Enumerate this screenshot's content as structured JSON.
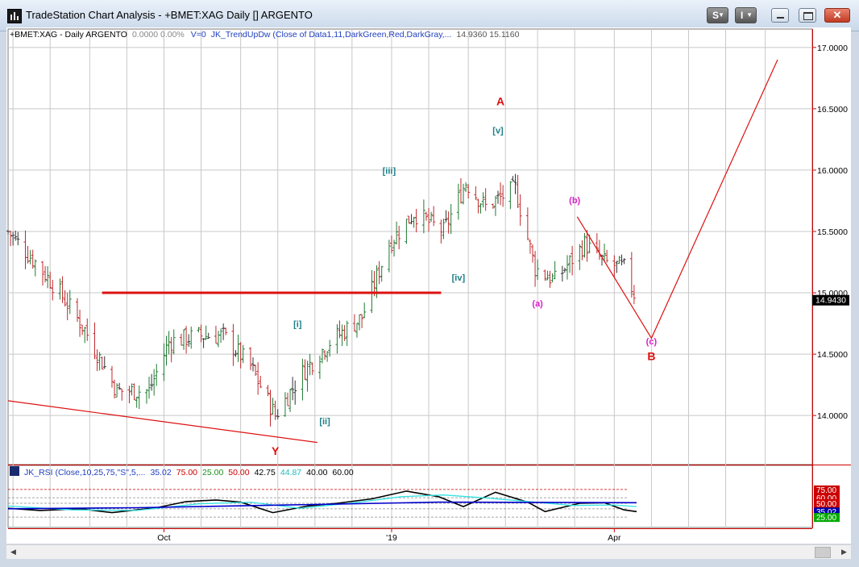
{
  "window": {
    "title": "TradeStation Chart Analysis - +BMET:XAG Daily [] ARGENTO",
    "btn_s": "S",
    "btn_i": "I",
    "btn_close_glyph": "✕",
    "icons": {
      "app": "chart-app-icon",
      "minimize": "minimize-icon",
      "maximize": "maximize-icon",
      "close": "close-icon"
    }
  },
  "price_header": {
    "symbol_text": "+BMET:XAG - Daily  ARGENTO",
    "stats_text": "0.0000   0.00%",
    "volume_text": "V=0",
    "indicator_text": "JK_TrendUpDw (Close of Data1,11,DarkGreen,Red,DarkGray,...",
    "values_text": "14.9360   15.1160"
  },
  "rsi_header": {
    "name_text": "JK_RSI (Close,10,25,75,\"S\",5,...",
    "v1": "35.02",
    "v2": "75.00",
    "v3": "25.00",
    "v4": "50.00",
    "v5": "42.75",
    "v6": "44.87",
    "v7": "40.00",
    "v8": "60.00"
  },
  "chart_data": [
    {
      "type": "bar",
      "subtype": "ohlc",
      "x_axis": {
        "labels": [
          "Oct",
          "'19",
          "Apr"
        ],
        "range": [
          "2018-07-30",
          "2019-06-20"
        ],
        "label_dates": [
          "2018-10-01",
          "2019-01-01",
          "2019-04-01"
        ]
      },
      "y_axis": {
        "ylim": [
          13.6,
          17.15
        ],
        "ticks": [
          "14.0000",
          "14.5000",
          "15.0000",
          "15.5000",
          "16.0000",
          "16.5000",
          "17.0000"
        ],
        "tick_values": [
          14.0,
          14.5,
          15.0,
          15.5,
          16.0,
          16.5,
          17.0
        ]
      },
      "last_price": 14.943,
      "last_price_text": "14.9430",
      "grid": true,
      "colors": {
        "up": "#1e7b32",
        "down": "#c0282d",
        "neutral": "#333333",
        "annotation_red": "#dd1111",
        "annotation_teal": "#1a7f86",
        "annotation_magenta": "#d81fc8"
      },
      "series": [
        {
          "name": "+BMET:XAG",
          "approx_closes": [
            [
              "2018-07-30",
              15.5
            ],
            [
              "2018-08-10",
              15.25
            ],
            [
              "2018-08-20",
              15.0
            ],
            [
              "2018-08-30",
              14.7
            ],
            [
              "2018-09-12",
              14.2
            ],
            [
              "2018-09-25",
              14.2
            ],
            [
              "2018-10-03",
              14.6
            ],
            [
              "2018-10-15",
              14.65
            ],
            [
              "2018-10-25",
              14.65
            ],
            [
              "2018-11-05",
              14.4
            ],
            [
              "2018-11-15",
              14.0
            ],
            [
              "2018-11-26",
              14.35
            ],
            [
              "2018-12-07",
              14.6
            ],
            [
              "2018-12-20",
              14.8
            ],
            [
              "2018-12-31",
              15.4
            ],
            [
              "2019-01-10",
              15.65
            ],
            [
              "2019-01-22",
              15.5
            ],
            [
              "2019-01-31",
              15.9
            ],
            [
              "2019-02-08",
              15.7
            ],
            [
              "2019-02-20",
              15.85
            ],
            [
              "2019-02-28",
              15.2
            ],
            [
              "2019-03-08",
              15.1
            ],
            [
              "2019-03-20",
              15.4
            ],
            [
              "2019-03-28",
              15.25
            ],
            [
              "2019-04-05",
              15.2
            ],
            [
              "2019-04-10",
              14.94
            ]
          ]
        }
      ],
      "lines": [
        {
          "name": "support",
          "color": "#dd1111",
          "points": [
            [
              "2018-07-30",
              14.12
            ],
            [
              "2018-12-02",
              13.78
            ]
          ]
        },
        {
          "name": "resistance",
          "color": "#dd1111",
          "points": [
            [
              "2018-09-06",
              15.0
            ],
            [
              "2019-01-21",
              15.0
            ]
          ]
        },
        {
          "name": "projection",
          "color": "#dd1111",
          "points": [
            [
              "2019-03-17",
              15.62
            ],
            [
              "2019-04-16",
              14.63
            ],
            [
              "2019-06-06",
              16.9
            ]
          ]
        }
      ],
      "annotations": [
        {
          "text": "A",
          "x": "2019-02-14",
          "y": 16.53,
          "color": "red"
        },
        {
          "text": "Y",
          "x": "2018-11-15",
          "y": 13.68,
          "color": "red"
        },
        {
          "text": "B",
          "x": "2019-04-16",
          "y": 14.45,
          "color": "red"
        },
        {
          "text": "[v]",
          "x": "2019-02-13",
          "y": 16.3,
          "color": "teal"
        },
        {
          "text": "[iii]",
          "x": "2018-12-31",
          "y": 15.97,
          "color": "teal"
        },
        {
          "text": "[iv]",
          "x": "2019-01-28",
          "y": 15.1,
          "color": "teal"
        },
        {
          "text": "[i]",
          "x": "2018-11-24",
          "y": 14.72,
          "color": "teal"
        },
        {
          "text": "[ii]",
          "x": "2018-12-05",
          "y": 13.93,
          "color": "teal"
        },
        {
          "text": "(b)",
          "x": "2019-03-16",
          "y": 15.73,
          "color": "magenta"
        },
        {
          "text": "(a)",
          "x": "2019-03-01",
          "y": 14.89,
          "color": "magenta"
        },
        {
          "text": "(c)",
          "x": "2019-04-16",
          "y": 14.58,
          "color": "magenta"
        }
      ]
    },
    {
      "type": "line",
      "name": "JK_RSI",
      "y_axis": {
        "ylim": [
          12,
          88
        ],
        "tick_values": [
          75,
          60,
          50,
          35.02,
          25
        ]
      },
      "axis_labels": [
        "75.00",
        "60.00",
        "50.00",
        "35.02",
        "25.00"
      ],
      "axis_label_colors": [
        "#cc0000",
        "#cc0000",
        "#cc0000",
        "#0000aa",
        "#00aa00"
      ],
      "levels": [
        75,
        60,
        50,
        40,
        25
      ],
      "series": [
        {
          "name": "RSI",
          "color": "#000000",
          "points": [
            [
              "2018-07-30",
              41
            ],
            [
              "2018-08-12",
              37
            ],
            [
              "2018-08-28",
              40
            ],
            [
              "2018-09-10",
              33
            ],
            [
              "2018-09-28",
              42
            ],
            [
              "2018-10-10",
              53
            ],
            [
              "2018-10-22",
              56
            ],
            [
              "2018-11-01",
              52
            ],
            [
              "2018-11-14",
              33
            ],
            [
              "2018-11-28",
              45
            ],
            [
              "2018-12-10",
              50
            ],
            [
              "2018-12-24",
              58
            ],
            [
              "2019-01-07",
              72
            ],
            [
              "2019-01-20",
              62
            ],
            [
              "2019-01-30",
              44
            ],
            [
              "2019-02-12",
              70
            ],
            [
              "2019-02-25",
              52
            ],
            [
              "2019-03-04",
              35
            ],
            [
              "2019-03-18",
              50
            ],
            [
              "2019-03-28",
              51
            ],
            [
              "2019-04-05",
              38
            ],
            [
              "2019-04-10",
              35
            ]
          ]
        },
        {
          "name": "Signal",
          "color": "#33e3e3",
          "points": [
            [
              "2018-07-30",
              45
            ],
            [
              "2018-08-25",
              38
            ],
            [
              "2018-09-20",
              37
            ],
            [
              "2018-10-15",
              49
            ],
            [
              "2018-11-05",
              52
            ],
            [
              "2018-11-25",
              41
            ],
            [
              "2018-12-15",
              50
            ],
            [
              "2019-01-05",
              62
            ],
            [
              "2019-01-22",
              65
            ],
            [
              "2019-02-10",
              59
            ],
            [
              "2019-02-28",
              52
            ],
            [
              "2019-03-15",
              46
            ],
            [
              "2019-04-01",
              47
            ],
            [
              "2019-04-10",
              44
            ]
          ]
        },
        {
          "name": "Baseline",
          "color": "#0000cc",
          "points": [
            [
              "2018-07-30",
              40
            ],
            [
              "2018-09-20",
              42
            ],
            [
              "2018-11-20",
              47
            ],
            [
              "2019-01-20",
              52
            ],
            [
              "2019-04-10",
              51
            ]
          ]
        }
      ]
    }
  ]
}
